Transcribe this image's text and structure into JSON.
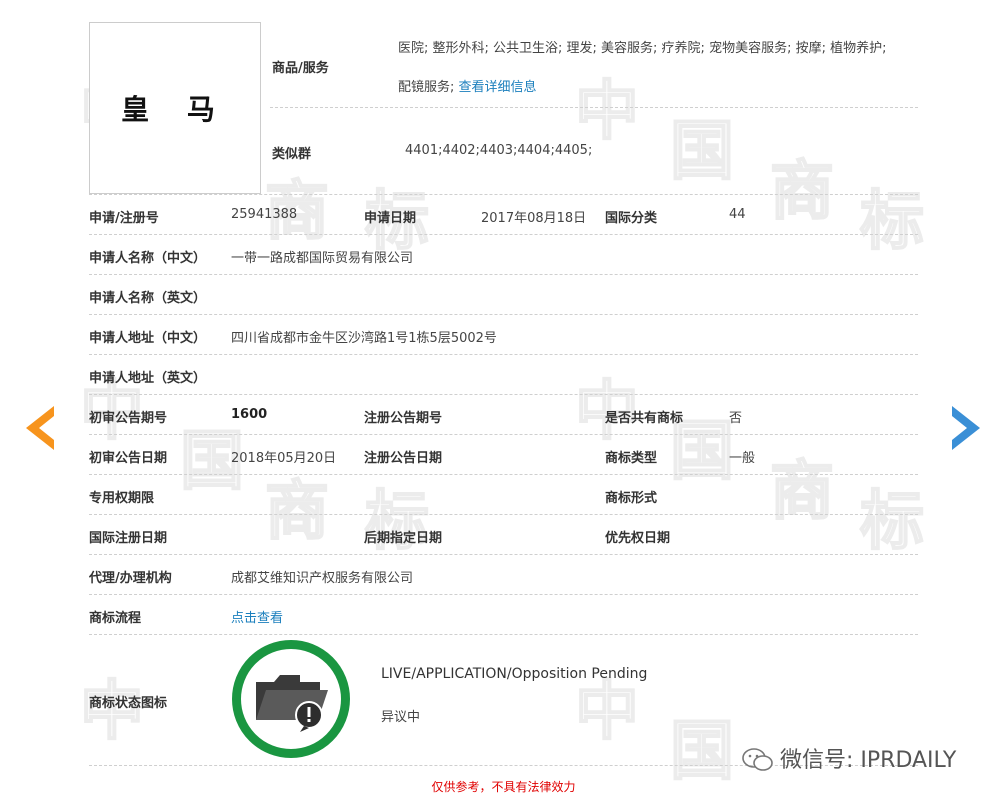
{
  "trademark": {
    "name": "皇 马",
    "goods_services_label": "商品/服务",
    "goods_services_text_line1": "医院; 整形外科; 公共卫生浴; 理发; 美容服务; 疗养院; 宠物美容服务; 按摩; 植物养护;",
    "goods_services_text_line2": "配镜服务;",
    "goods_services_link": "查看详细信息",
    "similar_group_label": "类似群",
    "similar_group_value": "4401;4402;4403;4404;4405;"
  },
  "fields": {
    "reg_no_label": "申请/注册号",
    "reg_no_value": "25941388",
    "app_date_label": "申请日期",
    "app_date_value": "2017年08月18日",
    "intl_class_label": "国际分类",
    "intl_class_value": "44",
    "applicant_cn_label": "申请人名称（中文）",
    "applicant_cn_value": "一带一路成都国际贸易有限公司",
    "applicant_en_label": "申请人名称（英文）",
    "address_cn_label": "申请人地址（中文）",
    "address_cn_value": "四川省成都市金牛区沙湾路1号1栋5层5002号",
    "address_en_label": "申请人地址（英文）",
    "prelim_issue_label": "初审公告期号",
    "prelim_issue_value": "1600",
    "reg_issue_label": "注册公告期号",
    "shared_label": "是否共有商标",
    "shared_value": "否",
    "prelim_date_label": "初审公告日期",
    "prelim_date_value": "2018年05月20日",
    "reg_date_label": "注册公告日期",
    "tm_type_label": "商标类型",
    "tm_type_value": "一般",
    "exclusive_period_label": "专用权期限",
    "tm_form_label": "商标形式",
    "intl_reg_date_label": "国际注册日期",
    "later_designation_label": "后期指定日期",
    "priority_date_label": "优先权日期",
    "agent_label": "代理/办理机构",
    "agent_value": "成都艾维知识产权服务有限公司",
    "process_label": "商标流程",
    "process_link": "点击查看",
    "status_icon_label": "商标状态图标",
    "status_en": "LIVE/APPLICATION/Opposition Pending",
    "status_cn": "异议中"
  },
  "footer": {
    "disclaimer": "仅供参考，不具有法律效力",
    "wechat_text": "微信号: IPRDAILY"
  },
  "watermark": [
    "中",
    "国",
    "商",
    "标"
  ],
  "colors": {
    "accent_orange": "#f7941d",
    "accent_blue": "#3a8fd6",
    "status_green": "#1a9641",
    "link_blue": "#1b7fbd",
    "disclaimer_red": "#e00000"
  }
}
